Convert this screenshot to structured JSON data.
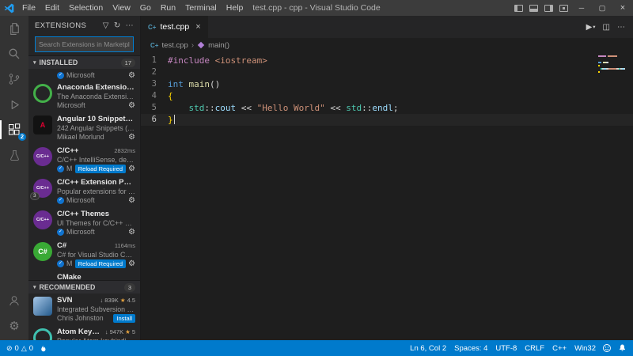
{
  "icons": {
    "filter": "▽",
    "refresh": "↻",
    "more": "⋯",
    "gear": "⚙",
    "verified_check": "✓",
    "star": "★",
    "downloads": "↓",
    "run": "▶",
    "dropdown": "▾",
    "split_editor": "◫",
    "close": "×",
    "minimize": "─",
    "maximize": "▢",
    "chevron_expanded": "▾",
    "breadcrumb_separator": "›",
    "error": "⊘",
    "warning": "△",
    "cpp_file": "C+"
  },
  "titlebar": {
    "menus": [
      "File",
      "Edit",
      "Selection",
      "View",
      "Go",
      "Run",
      "Terminal",
      "Help"
    ],
    "title": "test.cpp - cpp - Visual Studio Code"
  },
  "activity_bar": {
    "extensions_badge": "2"
  },
  "sidebar": {
    "title": "EXTENSIONS",
    "search_placeholder": "Search Extensions in Marketplace",
    "installed": {
      "label": "INSTALLED",
      "count": "17"
    },
    "recommended": {
      "label": "RECOMMENDED",
      "count": "3"
    },
    "installed_items": [
      {
        "partial": "top",
        "publisher": "Microsoft",
        "verified": true,
        "gear": true
      },
      {
        "name": "Anaconda Extension Pack",
        "desc": "The Anaconda Extension Pac...",
        "publisher": "Microsoft",
        "gear": true,
        "icon": {
          "shape": "ring",
          "color": "#43b049"
        }
      },
      {
        "name": "Angular 10 Snippets - Typ...",
        "desc": "242 Angular Snippets (Type...",
        "publisher": "Mikael Morlund",
        "gear": true,
        "icon": {
          "shape": "square",
          "bg": "#121212",
          "label": "A",
          "fg": "#dd0031"
        }
      },
      {
        "name": "C/C++",
        "time": "2832ms",
        "desc": "C/C++ IntelliSense, debuggi...",
        "publisher": "Microsoft",
        "verified": true,
        "buttons": [
          "Reload Required"
        ],
        "gear": true,
        "icon": {
          "shape": "circle",
          "bg": "#6a2c91",
          "label": "C/C++",
          "fg": "#ffffff"
        }
      },
      {
        "name": "C/C++ Extension Pack",
        "desc": "Popular extensions for C++ ...",
        "publisher": "Microsoft",
        "verified": true,
        "gear": true,
        "icon": {
          "shape": "circle",
          "bg": "#6a2c91",
          "label": "C/C++",
          "fg": "#ffffff"
        },
        "icon_badge": "3"
      },
      {
        "name": "C/C++ Themes",
        "desc": "UI Themes for C/C++ extens...",
        "publisher": "Microsoft",
        "verified": true,
        "gear": true,
        "icon": {
          "shape": "circle",
          "bg": "#6a2c91",
          "label": "C/C++",
          "fg": "#ffffff"
        }
      },
      {
        "name": "C#",
        "time": "1164ms",
        "desc": "C# for Visual Studio Code (p...",
        "publisher": "Microsoft",
        "verified": true,
        "buttons": [
          "Reload Required"
        ],
        "gear": true,
        "icon": {
          "shape": "circle",
          "bg": "#39a935",
          "label": "C#",
          "fg": "#ffffff"
        }
      },
      {
        "partial": "bottom",
        "name": "CMake"
      }
    ],
    "recommended_items": [
      {
        "name": "SVN",
        "downloads": "839K",
        "rating": "4.5",
        "desc": "Integrated Subversion sourc...",
        "publisher": "Chris Johnston",
        "buttons": [
          "Install"
        ],
        "icon": {
          "shape": "square",
          "grad": [
            "#a7c7e7",
            "#235a8c"
          ]
        }
      },
      {
        "name": "Atom Keymap",
        "downloads": "947K",
        "rating": "5",
        "desc": "Popular Atom keybindings f...",
        "icon": {
          "shape": "ring",
          "color": "#3fc1b0"
        }
      }
    ]
  },
  "editor": {
    "tab": {
      "label": "test.cpp"
    },
    "breadcrumb": {
      "file": "test.cpp",
      "symbol": "main()"
    },
    "token_colors": {
      "pp": "#C586C0",
      "str": "#CE9178",
      "kw": "#569CD6",
      "fn": "#DCDCAA",
      "ns": "#4EC9B0",
      "var": "#9CDCFE",
      "pl": "#D4D4D4",
      "br": "#FFD700"
    },
    "code": [
      {
        "n": "1",
        "tokens": [
          [
            "#include",
            "pp"
          ],
          [
            " ",
            "pl"
          ],
          [
            "<iostream>",
            "str"
          ]
        ]
      },
      {
        "n": "2",
        "tokens": []
      },
      {
        "n": "3",
        "tokens": [
          [
            "int",
            "kw"
          ],
          [
            " ",
            "pl"
          ],
          [
            "main",
            "fn"
          ],
          [
            "()",
            "pl"
          ]
        ]
      },
      {
        "n": "4",
        "tokens": [
          [
            "{",
            "br"
          ]
        ]
      },
      {
        "n": "5",
        "tokens": [
          [
            "    ",
            "pl"
          ],
          [
            "std",
            "ns"
          ],
          [
            "::",
            "pl"
          ],
          [
            "cout",
            "var"
          ],
          [
            " << ",
            "pl"
          ],
          [
            "\"Hello World\"",
            "str"
          ],
          [
            " << ",
            "pl"
          ],
          [
            "std",
            "ns"
          ],
          [
            "::",
            "pl"
          ],
          [
            "endl",
            "var"
          ],
          [
            ";",
            "pl"
          ]
        ]
      },
      {
        "n": "6",
        "tokens": [
          [
            "}",
            "br"
          ]
        ],
        "cursor": true
      }
    ]
  },
  "statusbar": {
    "errors": "0",
    "warnings": "0",
    "right": [
      {
        "name": "cursor-position",
        "label": "Ln 6, Col 2"
      },
      {
        "name": "indentation",
        "label": "Spaces: 4"
      },
      {
        "name": "encoding",
        "label": "UTF-8"
      },
      {
        "name": "eol",
        "label": "CRLF"
      },
      {
        "name": "language-mode",
        "label": "C++"
      },
      {
        "name": "platform",
        "label": "Win32"
      }
    ]
  }
}
